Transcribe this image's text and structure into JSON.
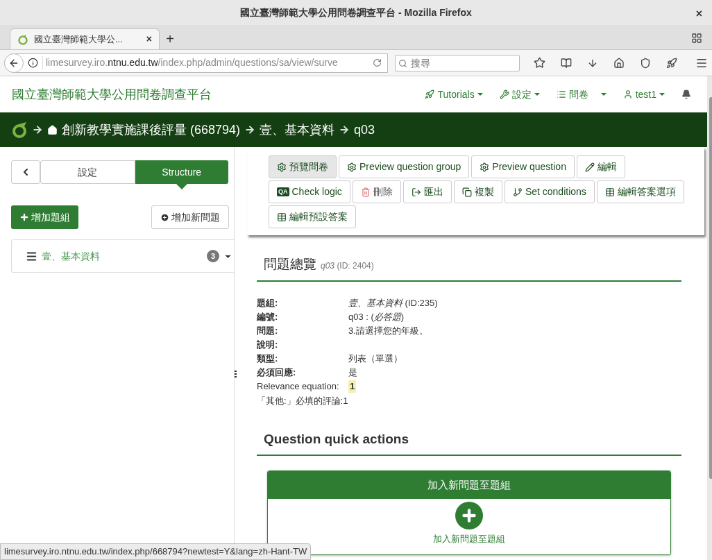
{
  "window": {
    "title": "國立臺灣師範大學公用問卷調查平台 - Mozilla Firefox",
    "close": "×"
  },
  "browser_tabs": [
    {
      "label": "國立臺灣師範大學公...",
      "selected": true,
      "close": "×"
    }
  ],
  "new_tab": "+",
  "address": {
    "host_pre": "limesurvey.iro.",
    "host_main": "ntnu.edu.tw",
    "path": "/index.php/admin/questions/sa/view/surve"
  },
  "search": {
    "placeholder": "搜尋"
  },
  "site": {
    "brand": "國立臺灣師範大學公用問卷調查平台",
    "menu": [
      {
        "kind": "rocket",
        "label": "Tutorials"
      },
      {
        "kind": "wrench",
        "label": "設定"
      },
      {
        "kind": "list",
        "label": "問卷"
      },
      {
        "kind": "user",
        "label": "test1"
      },
      {
        "kind": "bell"
      }
    ]
  },
  "breadcrumb": [
    {
      "kind": "home",
      "label": "創新教學實施課後評量 (668794)"
    },
    {
      "kind": "plain",
      "label": "壹、基本資料"
    },
    {
      "kind": "plain",
      "label": "q03"
    }
  ],
  "sidebar": {
    "tabs": [
      {
        "label": "設定",
        "selected": false
      },
      {
        "label": "Structure",
        "selected": true
      }
    ],
    "add_group": "增加題組",
    "add_question": "增加新問題",
    "groups": [
      {
        "label": "壹、基本資料",
        "count": "3"
      }
    ]
  },
  "toolbar": [
    {
      "kind": "preview",
      "label": "預覽問卷",
      "hovered": true
    },
    {
      "kind": "preview",
      "label": "Preview question group",
      "hovered": false
    },
    {
      "kind": "preview",
      "label": "Preview question",
      "hovered": false
    },
    {
      "kind": "edit",
      "label": "編輯",
      "hovered": false
    },
    {
      "kind": "logic",
      "badge": "QA",
      "label": "Check logic",
      "hovered": false
    },
    {
      "kind": "delete",
      "label": "刪除",
      "hovered": false
    },
    {
      "kind": "export",
      "label": "匯出",
      "hovered": false
    },
    {
      "kind": "copy",
      "label": "複製",
      "hovered": false
    },
    {
      "kind": "conditions",
      "label": "Set conditions",
      "hovered": false
    },
    {
      "kind": "answers",
      "label": "編輯答案選項",
      "hovered": false
    },
    {
      "kind": "answers",
      "label": "編輯預設答案",
      "hovered": false
    }
  ],
  "overview": {
    "title": "問題總覽",
    "code": "q03",
    "id": "(ID: 2404)",
    "rows": [
      {
        "kind": "field",
        "label": "題組:",
        "value": "*壹、基本資料* (ID:235)"
      },
      {
        "kind": "field",
        "label": "編號:",
        "value": "q03 : (*必答題*)"
      },
      {
        "kind": "field",
        "label": "問題:",
        "value": "3.請選擇您的年級。"
      },
      {
        "kind": "field",
        "label": "說明:"
      },
      {
        "kind": "field",
        "label": "類型:",
        "value": "列表（單選）"
      },
      {
        "kind": "field",
        "label": "必須回應:",
        "value": "是"
      },
      {
        "kind": "equation",
        "label": "Relevance equation:",
        "value": "1"
      },
      {
        "kind": "plain",
        "label": "「其他:」必填的評論:1"
      }
    ]
  },
  "quick_actions": {
    "title": "Question quick actions",
    "card_title": "加入新問題至題組",
    "card_link": "加入新問題至題組"
  },
  "status_url": "limesurvey.iro.ntnu.edu.tw/index.php/668794?newtest=Y&lang=zh-Hant-TW"
}
